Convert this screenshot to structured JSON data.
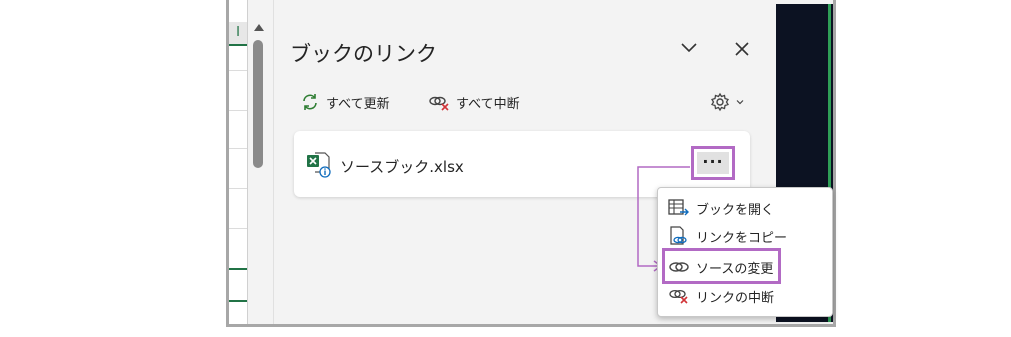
{
  "panel": {
    "title": "ブックのリンク",
    "refresh_all_label": "すべて更新",
    "break_all_label": "すべて中断"
  },
  "sheet": {
    "column_header": "I"
  },
  "link_card": {
    "file_name": "ソースブック.xlsx",
    "more_label": "···"
  },
  "context_menu": {
    "items": [
      {
        "label": "ブックを開く",
        "icon": "open-workbook-icon"
      },
      {
        "label": "リンクをコピー",
        "icon": "copy-link-icon"
      },
      {
        "label": "ソースの変更",
        "icon": "change-source-icon"
      },
      {
        "label": "リンクの中断",
        "icon": "break-link-icon"
      }
    ]
  },
  "colors": {
    "highlight": "#b26ac4",
    "excel_green": "#217346",
    "dark_bg": "#0c1222"
  }
}
